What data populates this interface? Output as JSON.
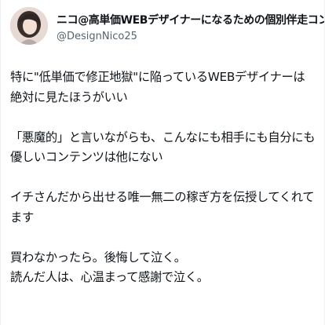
{
  "author": {
    "display_name": "ニコ@高単価WEBデザイナーになるための個別伴走コンサル",
    "handle": "@DesignNico25"
  },
  "body": {
    "line1": "特に\"低単価で修正地獄\"に陥っているWEBデザイナーは絶対に見たほうがいい",
    "line2": "「悪魔的」と言いながらも、こんなにも相手にも自分にも優しいコンテンツは他にない",
    "line3": "イチさんだから出せる唯一無二の稼ぎ方を伝授してくれてます",
    "line4": "買わなかったら。後悔して泣く。",
    "line5": "読んだ人は、心温まって感謝で泣く。"
  },
  "colors": {
    "text": "#0f1419",
    "secondary_text": "#536471",
    "background": "#ffffff"
  }
}
